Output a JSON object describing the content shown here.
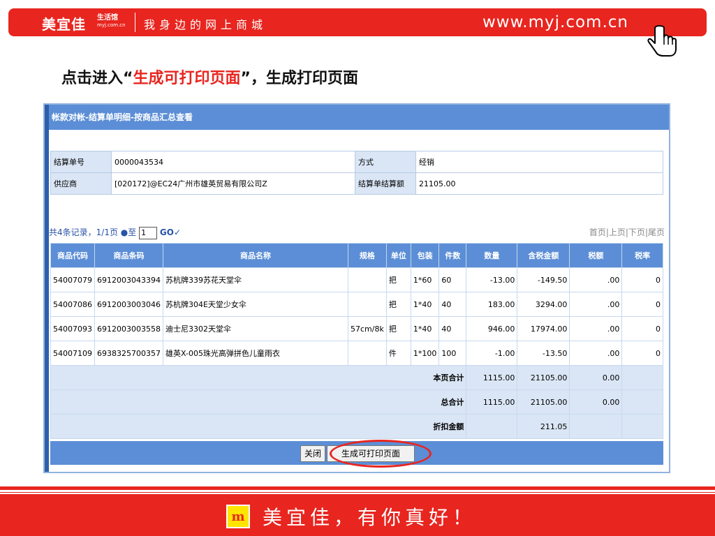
{
  "banner": {
    "brand": "美宜佳",
    "brand_sub": "生活馆",
    "brand_sub_small": "myj.com.cn",
    "slogan": "我身边的网上商城",
    "url": "www.myj.com.cn"
  },
  "headline": {
    "before": "点击进入“",
    "highlight": "生成可打印页面",
    "after": "”，生成打印页面"
  },
  "panel": {
    "title": "帐款对帐-结算单明细-按商品汇总查看",
    "info": {
      "settle_no_label": "结算单号",
      "settle_no": "0000043534",
      "mode_label": "方式",
      "mode": "经销",
      "supplier_label": "供应商",
      "supplier": "[020172]@EC24广州市雄英贸易有限公司Z",
      "amount_label": "结算单结算额",
      "amount": "21105.00"
    },
    "pager": {
      "summary": "共4条记录，1/1页",
      "goto_label": "●至",
      "page_value": "1",
      "go_label": "GO✓",
      "first": "首页",
      "prev": "上页",
      "next": "下页",
      "last": "尾页"
    },
    "columns": [
      "商品代码",
      "商品条码",
      "商品名称",
      "规格",
      "单位",
      "包装",
      "件数",
      "数量",
      "含税金额",
      "税额",
      "税率"
    ],
    "rows": [
      [
        "54007079",
        "6912003043394",
        "苏杭牌339苏花天堂伞",
        "",
        "把",
        "1*60",
        "60",
        "-13.00",
        "-149.50",
        ".00",
        "0"
      ],
      [
        "54007086",
        "6912003003046",
        "苏杭牌304E天堂少女伞",
        "",
        "把",
        "1*40",
        "40",
        "183.00",
        "3294.00",
        ".00",
        "0"
      ],
      [
        "54007093",
        "6912003003558",
        "迪士尼3302天堂伞",
        "57cm/8k",
        "把",
        "1*40",
        "40",
        "946.00",
        "17974.00",
        ".00",
        "0"
      ],
      [
        "54007109",
        "6938325700357",
        "雄英X-005珠光高弹拼色儿童雨衣",
        "",
        "件",
        "1*100",
        "100",
        "-1.00",
        "-13.50",
        ".00",
        "0"
      ]
    ],
    "page_total": {
      "label": "本页合计",
      "qty": "1115.00",
      "amount": "21105.00",
      "tax": "0.00"
    },
    "grand_total": {
      "label": "总合计",
      "qty": "1115.00",
      "amount": "21105.00",
      "tax": "0.00"
    },
    "discount": {
      "label": "折扣金额",
      "amount": "211.05"
    },
    "buttons": {
      "close": "关闭",
      "print": "生成可打印页面"
    }
  },
  "footer": {
    "slogan": "美宜佳，有你真好！",
    "logo_letter": "m"
  },
  "colors": {
    "brand_red": "#e8251f",
    "header_blue": "#5b8ed6",
    "light_blue": "#dae6f5"
  }
}
